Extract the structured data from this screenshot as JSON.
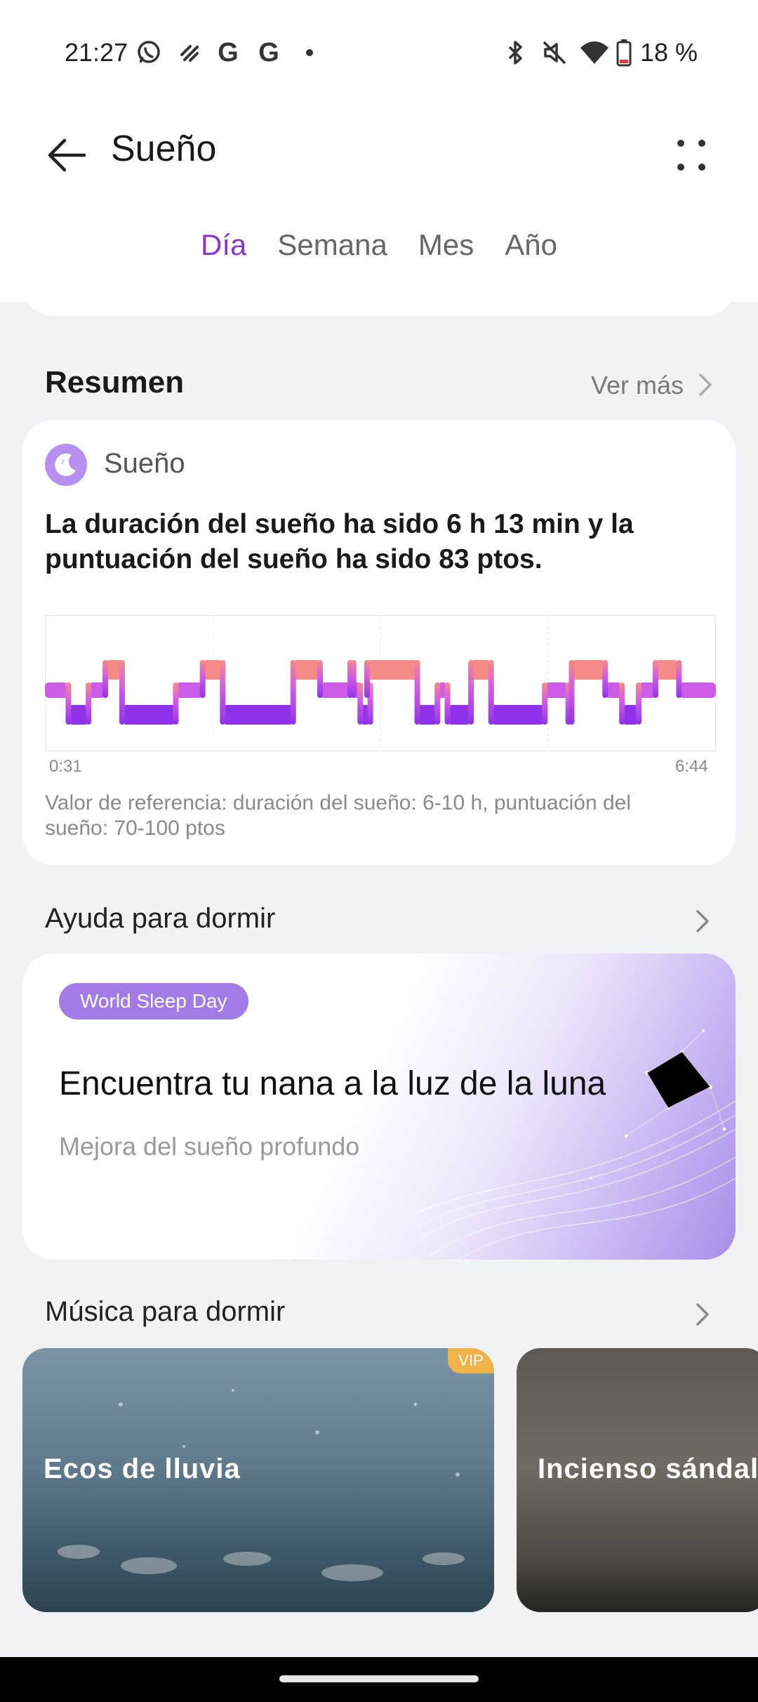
{
  "status_bar": {
    "time": "21:27",
    "icons_left": [
      "whatsapp-icon",
      "app-icon",
      "google-icon",
      "google-icon",
      "dot-icon"
    ],
    "icons_right": [
      "bluetooth-icon",
      "mute-icon",
      "wifi-icon",
      "battery-icon"
    ],
    "battery": "18 %"
  },
  "header": {
    "title": "Sueño"
  },
  "tabs": [
    {
      "label": "Día",
      "active": true
    },
    {
      "label": "Semana",
      "active": false
    },
    {
      "label": "Mes",
      "active": false
    },
    {
      "label": "Año",
      "active": false
    }
  ],
  "summary": {
    "heading": "Resumen",
    "see_more": "Ver más",
    "card_title": "Sueño",
    "text": "La duración del sueño ha sido 6 h 13 min y la puntuación del sueño ha sido 83 ptos.",
    "reference": "Valor de referencia: duración del sueño: 6-10 h, puntuación del sueño: 70-100 ptos",
    "start_time": "0:31",
    "end_time": "6:44"
  },
  "chart_data": {
    "type": "area",
    "x_start": "0:31",
    "x_end": "6:44",
    "levels": [
      "awake",
      "REM",
      "light",
      "deep"
    ],
    "stages": [
      {
        "stage": "light",
        "start": 0.0,
        "end": 0.035
      },
      {
        "stage": "deep",
        "start": 0.035,
        "end": 0.065
      },
      {
        "stage": "light",
        "start": 0.065,
        "end": 0.09
      },
      {
        "stage": "REM",
        "start": 0.09,
        "end": 0.115
      },
      {
        "stage": "deep",
        "start": 0.115,
        "end": 0.195
      },
      {
        "stage": "light",
        "start": 0.195,
        "end": 0.235
      },
      {
        "stage": "REM",
        "start": 0.235,
        "end": 0.265
      },
      {
        "stage": "deep",
        "start": 0.265,
        "end": 0.37
      },
      {
        "stage": "REM",
        "start": 0.37,
        "end": 0.41
      },
      {
        "stage": "light",
        "start": 0.41,
        "end": 0.455
      },
      {
        "stage": "REM",
        "start": 0.455,
        "end": 0.46
      },
      {
        "stage": "light",
        "start": 0.46,
        "end": 0.47
      },
      {
        "stage": "deep",
        "start": 0.47,
        "end": 0.485
      },
      {
        "stage": "light",
        "start": 0.485,
        "end": 0.48
      },
      {
        "stage": "REM",
        "start": 0.48,
        "end": 0.555
      },
      {
        "stage": "deep",
        "start": 0.555,
        "end": 0.585
      },
      {
        "stage": "light",
        "start": 0.585,
        "end": 0.6
      },
      {
        "stage": "deep",
        "start": 0.6,
        "end": 0.635
      },
      {
        "stage": "REM",
        "start": 0.635,
        "end": 0.665
      },
      {
        "stage": "deep",
        "start": 0.665,
        "end": 0.745
      },
      {
        "stage": "light",
        "start": 0.745,
        "end": 0.78
      },
      {
        "stage": "deep",
        "start": 0.78,
        "end": 0.785
      },
      {
        "stage": "REM",
        "start": 0.785,
        "end": 0.835
      },
      {
        "stage": "light",
        "start": 0.835,
        "end": 0.86
      },
      {
        "stage": "deep",
        "start": 0.86,
        "end": 0.885
      },
      {
        "stage": "light",
        "start": 0.885,
        "end": 0.91
      },
      {
        "stage": "REM",
        "start": 0.91,
        "end": 0.945
      },
      {
        "stage": "light",
        "start": 0.945,
        "end": 1.0
      }
    ],
    "colors": {
      "REM": "#f58a86",
      "light": "#cc5be8",
      "deep": "#8f33ea"
    },
    "grid": true
  },
  "sleep_help": {
    "heading": "Ayuda para dormir",
    "badge": "World Sleep Day",
    "title": "Encuentra tu nana a la luz de la luna",
    "subtitle": "Mejora del sueño profundo"
  },
  "sleep_music": {
    "heading": "Música para dormir",
    "items": [
      {
        "title": "Ecos de lluvia",
        "vip": "VIP"
      },
      {
        "title": "Incienso sándal",
        "vip": ""
      }
    ]
  },
  "colors": {
    "accent": "#8a33d6",
    "badge": "#a37be6",
    "vip": "#f0b34a"
  }
}
